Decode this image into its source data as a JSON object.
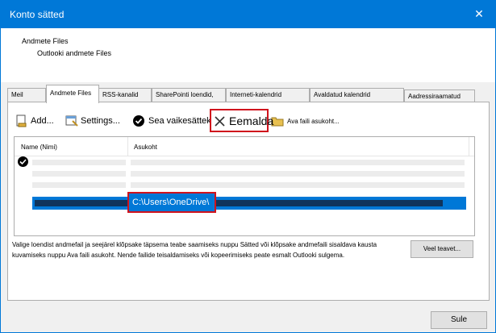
{
  "window": {
    "title": "Konto sätted"
  },
  "header": {
    "line1": "Andmete Files",
    "line2": "Outlooki andmete Files"
  },
  "tabs": [
    {
      "label": "Meil",
      "active": false
    },
    {
      "label": "Andmete Files",
      "active": true
    },
    {
      "label": "RSS-kanalid",
      "active": false
    },
    {
      "label": "SharePointi loendid,",
      "active": false
    },
    {
      "label": "Interneti-kalendrid",
      "active": false
    },
    {
      "label": "Avaldatud kalendrid",
      "active": false
    },
    {
      "label": "Aadressiraamatud",
      "active": false
    }
  ],
  "toolbar": {
    "add_label": "Add...",
    "settings_label": "Settings...",
    "set_default_label": "Sea vaikesätteks",
    "remove_label": "Eemalda",
    "open_location_label": "Ava faili asukoht..."
  },
  "list": {
    "col_name": "Name (Nimi)",
    "col_location": "Asukoht",
    "selected_path": "C:\\Users\\OneDrive\\"
  },
  "description": "Valige loendist andmefail ja seejärel klõpsake täpsema teabe saamiseks nuppu Sätted või klõpsake andmefaili sisaldava kausta kuvamiseks nuppu Ava faili asukoht. Nende failide teisaldamiseks või kopeerimiseks peate esmalt Outlooki sulgema.",
  "buttons": {
    "more_info": "Veel teavet...",
    "close": "Sule"
  },
  "colors": {
    "accent": "#0078d7",
    "highlight": "#d0131d"
  }
}
